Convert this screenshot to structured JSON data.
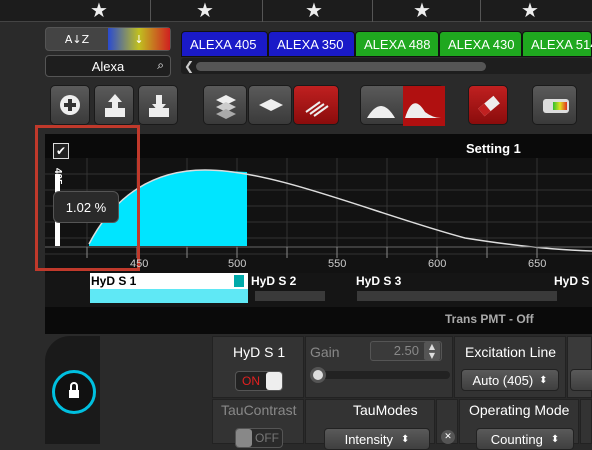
{
  "stars": [
    "★",
    "★",
    "★",
    "★",
    "★",
    "★"
  ],
  "sort": {
    "az_label": "A↓Z",
    "color_label": "↓"
  },
  "search": {
    "value": "Alexa",
    "icon": "search-icon"
  },
  "dye_tabs": [
    {
      "label": "ALEXA 405",
      "bg": "#1a1ac8"
    },
    {
      "label": "ALEXA 350",
      "bg": "#1a1ac8"
    },
    {
      "label": "ALEXA 488",
      "bg": "#1fa81f"
    },
    {
      "label": "ALEXA 430",
      "bg": "#1fa81f"
    },
    {
      "label": "ALEXA 514",
      "bg": "#1fa81f"
    }
  ],
  "toolbar": {
    "icons": [
      "add-icon",
      "upload-icon",
      "download-icon",
      "layers-icon",
      "diamond-icon",
      "stripes-icon",
      "spectrum-icon",
      "eraser-icon",
      "palette-icon"
    ]
  },
  "plot": {
    "setting_title": "Setting 1",
    "tick_labels": [
      "450",
      "500",
      "550",
      "600",
      "650"
    ],
    "laser_label": "405",
    "tooltip": "1.02 %",
    "accent": "#00e5ff"
  },
  "detectors": {
    "items": [
      "HyD S 1",
      "HyD S 2",
      "HyD S 3",
      "HyD S"
    ],
    "trans": "Trans PMT - Off"
  },
  "panel": {
    "detector_name": "HyD S 1",
    "on_label": "ON",
    "gain_label": "Gain",
    "gain_value": "2.50",
    "excitation_label": "Excitation Line",
    "excitation_value": "Auto (405)",
    "taucontrast_label": "TauContrast",
    "off_label": "OFF",
    "taumodes_label": "TauModes",
    "taumodes_value": "Intensity",
    "opmode_label": "Operating Mode",
    "opmode_value": "Counting"
  }
}
